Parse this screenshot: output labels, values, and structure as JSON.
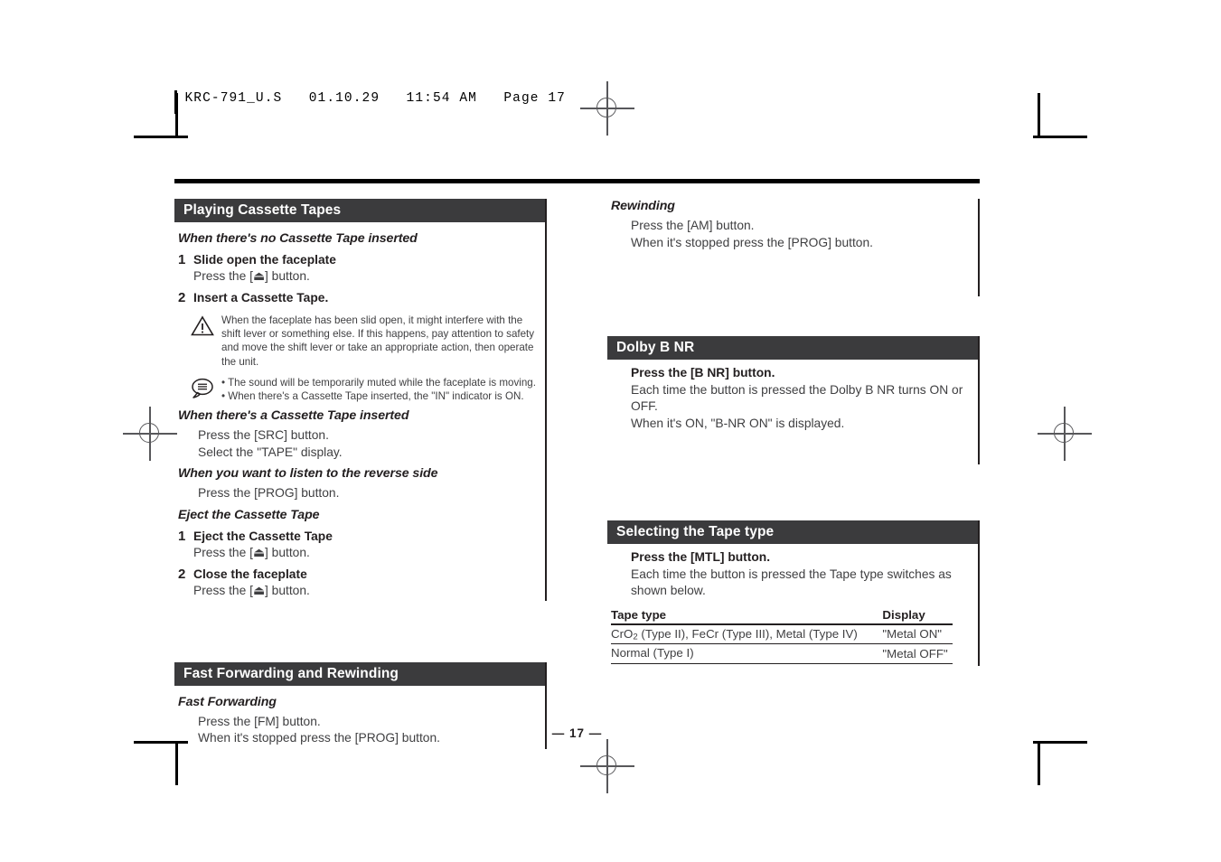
{
  "film_header": {
    "text": "KRC-791_U.S   01.10.29   11:54 AM   Page 17"
  },
  "page_number": "— 17 —",
  "sections": {
    "playing": {
      "title": "Playing Cassette Tapes",
      "sub_no_tape": "When there's no Cassette Tape inserted",
      "step1_num": "1",
      "step1_title": "Slide open the faceplate",
      "step1_text": "Press the [⏏] button.",
      "step2_num": "2",
      "step2_title": "Insert a Cassette Tape.",
      "warning": "When the faceplate has been slid open, it might interfere with the shift lever or something else. If this happens, pay attention to safety and move the shift lever or take an appropriate action, then operate the unit.",
      "note1": "• The sound will be temporarily muted while the faceplate is moving.",
      "note2": "• When there's a Cassette Tape inserted, the \"IN\" indicator is ON.",
      "sub_tape_inserted": "When there's a Cassette Tape inserted",
      "tape_inserted_line1": "Press the [SRC] button.",
      "tape_inserted_line2": "Select the \"TAPE\" display.",
      "sub_reverse": "When you want to listen to the reverse side",
      "reverse_line1": "Press the [PROG] button.",
      "sub_eject": "Eject the Cassette Tape",
      "eject_step1_num": "1",
      "eject_step1_title": "Eject the Cassette Tape",
      "eject_step1_text": "Press the [⏏] button.",
      "eject_step2_num": "2",
      "eject_step2_title": "Close the faceplate",
      "eject_step2_text": "Press the [⏏] button."
    },
    "fast_forward": {
      "title": "Fast Forwarding and Rewinding",
      "sub_ff": "Fast Forwarding",
      "ff_line1": "Press the [FM] button.",
      "ff_line2": "When it's stopped press the [PROG] button."
    },
    "rewinding": {
      "sub_rew": "Rewinding",
      "rew_line1": "Press the [AM] button.",
      "rew_line2": "When it's stopped press the [PROG] button."
    },
    "dolby": {
      "title": "Dolby B NR",
      "line1": "Press the [B NR] button.",
      "line2": "Each time the button is pressed the Dolby B NR turns ON or OFF.",
      "line3": "When it's ON, \"B-NR ON\" is displayed."
    },
    "tape_type": {
      "title": "Selecting the Tape type",
      "line1": "Press the [MTL] button.",
      "line2": "Each time the button is pressed the Tape type switches as shown below.",
      "table": {
        "headers": [
          "Tape type",
          "Display"
        ],
        "rows": [
          {
            "type_prefix": "CrO",
            "type_sub": "2",
            "type_rest": " (Type II), FeCr (Type III), Metal (Type IV)",
            "display": "\"Metal ON\""
          },
          {
            "type_prefix": "Normal (Type I)",
            "type_sub": "",
            "type_rest": "",
            "display": "\"Metal OFF\""
          }
        ]
      }
    }
  },
  "colors": {
    "bar_bg": "#3b3b3d",
    "bar_text": "#ffffff",
    "body_text": "#3f3f41",
    "rule": "#231f20"
  }
}
